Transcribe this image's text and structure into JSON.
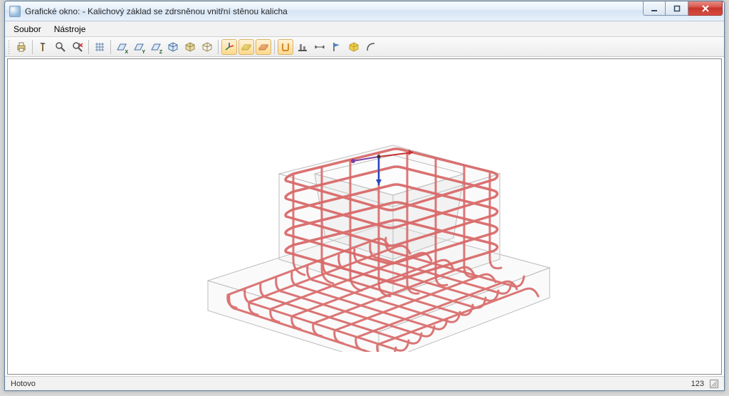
{
  "window": {
    "title": "Grafické okno: - Kalichový základ se zdrsněnou vnitřní stěnou kalicha"
  },
  "menu": {
    "file": "Soubor",
    "tools": "Nástroje"
  },
  "toolbar": {
    "print": "print",
    "tool_a": "tool",
    "zoom": "zoom",
    "zoom_cancel": "zoom-cancel",
    "grid": "grid",
    "axis_x": "X",
    "axis_y": "Y",
    "axis_z": "Z",
    "iso": "iso",
    "cube1": "view-cube",
    "cube2": "view-cube2",
    "axes3d": "axes3d",
    "plane_yellow": "plane",
    "plane_orange": "plane2",
    "tool_u": "U",
    "tool_align": "align",
    "tool_dim": "dim",
    "tool_flag": "flag",
    "tool_box": "box",
    "tool_arc": "arc"
  },
  "status": {
    "left": "Hotovo",
    "right": "123"
  },
  "model": {
    "rebar_color": "#d96a6a",
    "concrete_stroke": "#bcbcbc",
    "concrete_fill": "#f0f0f0",
    "axis_x_color": "#c83232",
    "axis_z_color": "#2846c0",
    "axis_origin_color": "#7a3ea6"
  }
}
